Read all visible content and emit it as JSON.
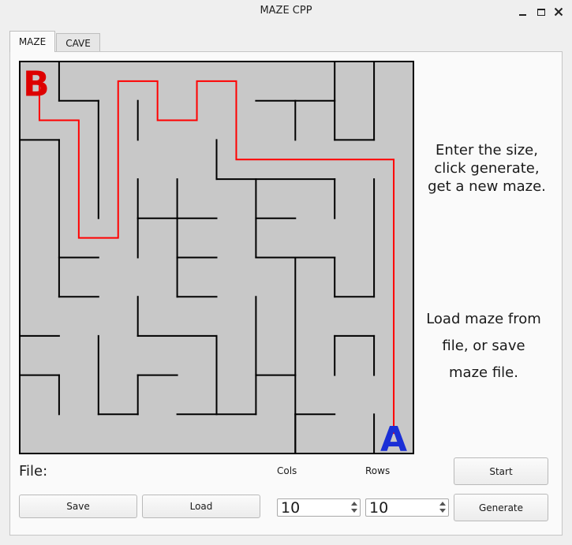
{
  "window": {
    "title": "MAZE CPP"
  },
  "tabs": [
    {
      "label": "MAZE",
      "active": true
    },
    {
      "label": "CAVE",
      "active": false
    }
  ],
  "hints": {
    "generate": [
      "Enter the size,",
      "click generate,",
      "get a new maze."
    ],
    "file": [
      "Load maze from",
      "file, or save",
      "maze file."
    ]
  },
  "controls": {
    "file_label": "File:",
    "cols_label": "Cols",
    "rows_label": "Rows",
    "cols_value": "10",
    "rows_value": "10",
    "start_label": "Start",
    "generate_label": "Generate",
    "save_label": "Save",
    "load_label": "Load"
  },
  "maze": {
    "cols": 10,
    "rows": 10,
    "start_marker": "A",
    "end_marker": "B",
    "background_color": "#c8c8c8",
    "wall_color": "#000000",
    "path_color": "#ff0000",
    "start_marker_color": "#1a2fd6",
    "end_marker_color": "#dd0000",
    "h_walls": [
      [
        1,
        1,
        2
      ],
      [
        6,
        1,
        8
      ],
      [
        0,
        2,
        1
      ],
      [
        8,
        2,
        9
      ],
      [
        5,
        3,
        8
      ],
      [
        3,
        4,
        5
      ],
      [
        6,
        4,
        7
      ],
      [
        1,
        5,
        2
      ],
      [
        4,
        5,
        5
      ],
      [
        6,
        5,
        8
      ],
      [
        1,
        6,
        2
      ],
      [
        4,
        6,
        5
      ],
      [
        8,
        6,
        9
      ],
      [
        0,
        7,
        1
      ],
      [
        3,
        7,
        5
      ],
      [
        8,
        7,
        9
      ],
      [
        0,
        8,
        1
      ],
      [
        3,
        8,
        4
      ],
      [
        6,
        8,
        7
      ],
      [
        2,
        9,
        3
      ],
      [
        4,
        9,
        6
      ],
      [
        7,
        9,
        8
      ]
    ],
    "v_walls": [
      [
        1,
        0,
        1
      ],
      [
        8,
        0,
        2
      ],
      [
        9,
        0,
        2
      ],
      [
        2,
        1,
        4
      ],
      [
        3,
        1,
        2
      ],
      [
        7,
        1,
        2
      ],
      [
        1,
        2,
        6
      ],
      [
        5,
        2,
        3
      ],
      [
        3,
        3,
        5
      ],
      [
        4,
        3,
        6
      ],
      [
        6,
        3,
        5
      ],
      [
        8,
        3,
        4
      ],
      [
        9,
        3,
        6
      ],
      [
        7,
        5,
        10
      ],
      [
        8,
        5,
        6
      ],
      [
        3,
        6,
        7
      ],
      [
        6,
        6,
        9
      ],
      [
        2,
        7,
        9
      ],
      [
        5,
        7,
        9
      ],
      [
        8,
        7,
        8
      ],
      [
        9,
        7,
        8
      ],
      [
        1,
        8,
        9
      ],
      [
        3,
        8,
        9
      ],
      [
        7,
        9,
        10
      ],
      [
        9,
        9,
        10
      ]
    ],
    "path": [
      [
        9,
        9
      ],
      [
        9,
        2
      ],
      [
        5,
        2
      ],
      [
        5,
        0
      ],
      [
        4,
        0
      ],
      [
        4,
        1
      ],
      [
        3,
        1
      ],
      [
        3,
        0
      ],
      [
        2,
        0
      ],
      [
        2,
        4
      ],
      [
        1,
        4
      ],
      [
        1,
        1
      ],
      [
        0,
        1
      ],
      [
        0,
        0
      ]
    ]
  }
}
